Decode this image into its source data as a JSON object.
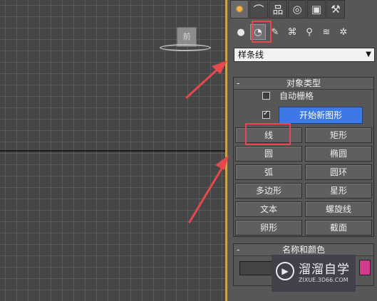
{
  "viewport": {
    "label": "前"
  },
  "command_panel": {
    "tabs": [
      {
        "name": "create-tab",
        "glyph": "✹"
      },
      {
        "name": "modify-tab",
        "glyph": "⌒"
      },
      {
        "name": "hierarchy-tab",
        "glyph": "品"
      },
      {
        "name": "motion-tab",
        "glyph": "◎"
      },
      {
        "name": "display-tab",
        "glyph": "▣"
      },
      {
        "name": "utilities-tab",
        "glyph": "⚒"
      }
    ],
    "subcategories": [
      {
        "name": "geometry-icon",
        "glyph": "●"
      },
      {
        "name": "shapes-icon",
        "glyph": "◔"
      },
      {
        "name": "lights-icon",
        "glyph": "✎"
      },
      {
        "name": "cameras-icon",
        "glyph": "⌘"
      },
      {
        "name": "helpers-icon",
        "glyph": "⚲"
      },
      {
        "name": "space-warps-icon",
        "glyph": "≋"
      },
      {
        "name": "systems-icon",
        "glyph": "✲"
      }
    ],
    "dropdown_value": "样条线",
    "object_type": {
      "title": "对象类型",
      "collapse": "-",
      "autogrid_label": "自动栅格",
      "autogrid_checked": false,
      "start_new_shape_checked": true,
      "start_new_shape_label": "开始新图形",
      "buttons": [
        "线",
        "矩形",
        "圆",
        "椭圆",
        "弧",
        "圆环",
        "多边形",
        "星形",
        "文本",
        "螺旋线",
        "卵形",
        "截面"
      ]
    },
    "name_color": {
      "title": "名称和颜色",
      "collapse": "-",
      "name_value": ""
    }
  },
  "watermark": {
    "brand": "溜溜自学",
    "url": "ZIXUE.3D66.COM"
  },
  "colors": {
    "highlight": "#e5484d",
    "start_button": "#3c78e6",
    "object_color": "#d43c8e",
    "viewport_frame": "#c9a64a"
  }
}
